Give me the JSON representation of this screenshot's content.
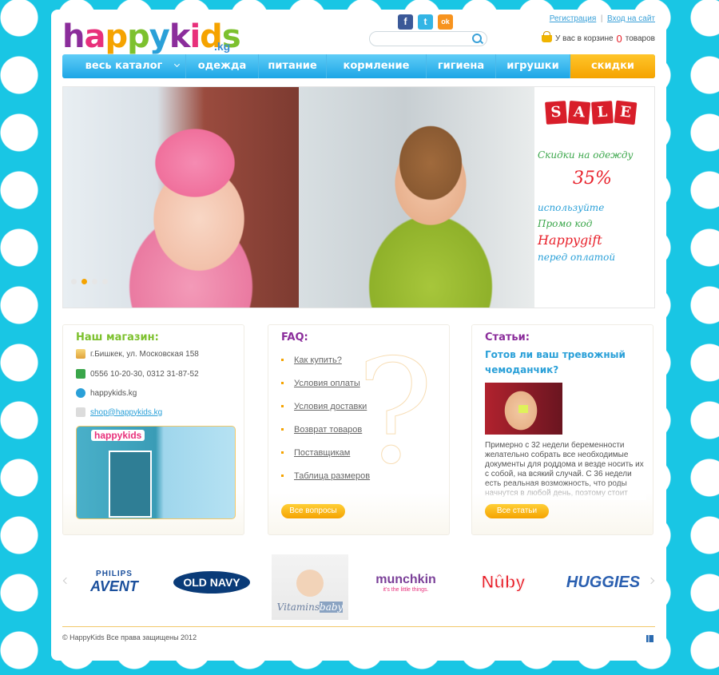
{
  "header": {
    "logo_text": "happykids",
    "logo_suffix": ".kg",
    "register_link": "Регистрация",
    "divider": "|",
    "login_link": "Вход на сайт",
    "cart_prefix": "У вас в корзине",
    "cart_count": "0",
    "cart_suffix": "товаров",
    "search_placeholder": ""
  },
  "social": [
    {
      "name": "facebook",
      "glyph": "f",
      "color": "#3b5998"
    },
    {
      "name": "twitter",
      "glyph": "t",
      "color": "#33b5e5"
    },
    {
      "name": "odnoklassniki",
      "glyph": "ok",
      "color": "#f7931e"
    }
  ],
  "nav": [
    {
      "label": "весь каталог",
      "has_dropdown": true
    },
    {
      "label": "одежда"
    },
    {
      "label": "питание"
    },
    {
      "label": "кормление"
    },
    {
      "label": "гигиена"
    },
    {
      "label": "игрушки"
    },
    {
      "label": "скидки",
      "highlight": true
    }
  ],
  "banner": {
    "sale_letters": [
      "S",
      "A",
      "L",
      "E"
    ],
    "line1": "Скидки на одежду",
    "line2": "35%",
    "line3": "используйте",
    "line4": "Промо код",
    "line5": "Happygift",
    "line6": "перед оплатой",
    "active_slide": 2,
    "slide_count": 4
  },
  "store": {
    "title": "Наш магазин:",
    "address": "г.Бишкек, ул. Московская 158",
    "phones": "0556 10-20-30, 0312 31-87-52",
    "skype": "happykids.kg",
    "email": "shop@happykids.kg",
    "image_label": "happykids"
  },
  "faq": {
    "title": "FAQ:",
    "items": [
      "Как купить?",
      "Условия оплаты",
      "Условия доставки",
      "Возврат товаров",
      "Поставщикам",
      "Таблица размеров"
    ],
    "button": "Все вопросы"
  },
  "articles": {
    "title": "Статьи:",
    "headline": "Готов ли ваш тревожный чемоданчик?",
    "text": "Примерно с 32 недели беременности желательно собрать все необходимые документы для роддома и везде носить их с собой, на всякий случай. С 36 недели есть реальная возможность, что роды начнутся в любой день, поэтому стоит",
    "button": "Все статьи"
  },
  "brands": {
    "philips_top": "PHILIPS",
    "philips_bottom": "AVENT",
    "oldnavy": "OLD NAVY",
    "vitamins_a": "Vitamins",
    "vitamins_b": "baby",
    "munchkin": "munchkin",
    "munchkin_tag": "it's the little things.",
    "nuby": "Nûby",
    "huggies": "HUGGIES"
  },
  "footer": {
    "copyright": "© HappyKids Все права защищены 2012"
  },
  "colors": {
    "accent_blue": "#1da6e6",
    "sale_orange": "#f5a300",
    "title_green": "#7dc12e",
    "title_purple": "#8b2d9b",
    "title_pink": "#e8307b"
  }
}
